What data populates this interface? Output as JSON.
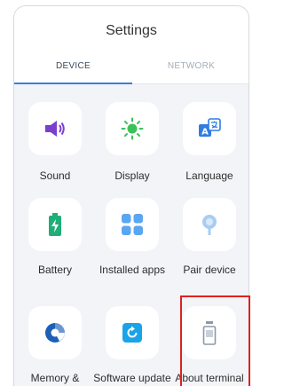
{
  "header": {
    "title": "Settings"
  },
  "tabs": [
    {
      "label": "DEVICE"
    },
    {
      "label": "NETWORK"
    }
  ],
  "items": [
    {
      "label": "Sound",
      "icon": "speaker-icon"
    },
    {
      "label": "Display",
      "icon": "sun-icon"
    },
    {
      "label": "Language",
      "icon": "translate-icon"
    },
    {
      "label": "Battery",
      "icon": "battery-icon"
    },
    {
      "label": "Installed apps",
      "icon": "apps-grid-icon"
    },
    {
      "label": "Pair device",
      "icon": "pair-device-icon"
    },
    {
      "label": "Memory & storage",
      "icon": "storage-pie-icon"
    },
    {
      "label": "Software update",
      "icon": "software-update-icon"
    },
    {
      "label": "About terminal",
      "icon": "terminal-icon"
    }
  ],
  "colors": {
    "tab_accent": "#3a7fd8",
    "highlight": "#e0201f",
    "sound": "#7b3fd0",
    "display": "#3cc15a",
    "language": "#2f7de1",
    "battery": "#1fae78",
    "apps": "#5aa6f0",
    "pair": "#a9cdf2",
    "storage": "#1d5fb8",
    "update": "#1aa3e8",
    "terminal": "#8c9aa8"
  }
}
